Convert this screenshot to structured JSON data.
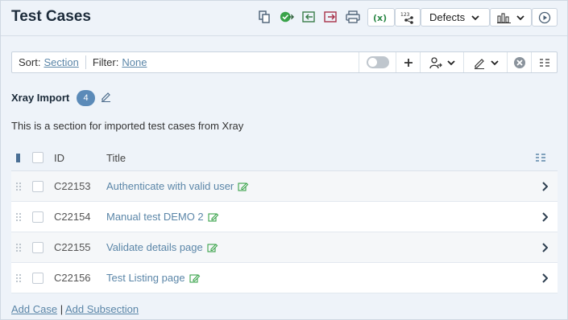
{
  "header": {
    "title": "Test Cases",
    "defects_label": "Defects"
  },
  "toolbar": {
    "sort_label": "Sort:",
    "sort_value": "Section",
    "filter_label": "Filter:",
    "filter_value": "None"
  },
  "section": {
    "name": "Xray Import",
    "count": "4",
    "description": "This is a section for imported test cases from Xray"
  },
  "table": {
    "columns": {
      "id": "ID",
      "title": "Title"
    },
    "rows": [
      {
        "id": "C22153",
        "title": "Authenticate with valid user"
      },
      {
        "id": "C22154",
        "title": "Manual test DEMO 2"
      },
      {
        "id": "C22155",
        "title": "Validate details page"
      },
      {
        "id": "C22156",
        "title": "Test Listing page"
      }
    ]
  },
  "footer": {
    "add_case": "Add Case",
    "separator": "|",
    "add_subsection": "Add Subsection"
  },
  "colors": {
    "accent": "#5b86a8",
    "badge": "#5b8ab8",
    "green": "#3aa34a",
    "red": "#c0392b"
  }
}
